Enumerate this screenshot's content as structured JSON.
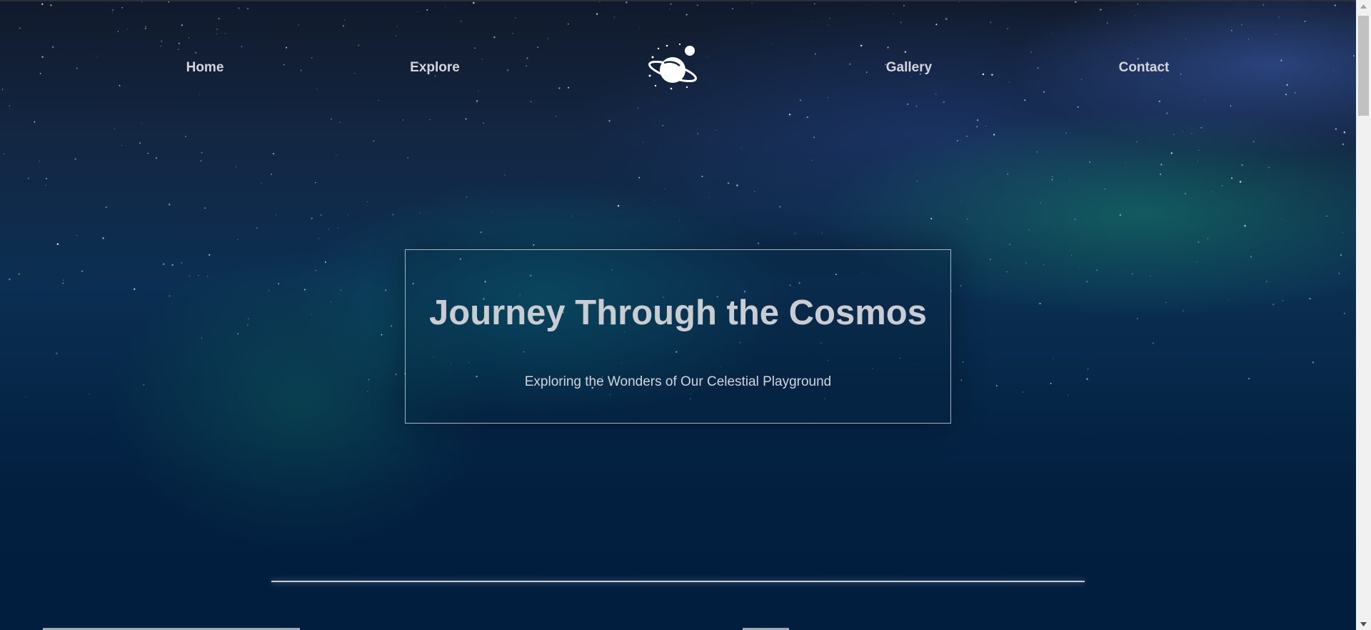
{
  "nav": {
    "items": [
      {
        "label": "Home"
      },
      {
        "label": "Explore"
      },
      {
        "label": "Gallery"
      },
      {
        "label": "Contact"
      }
    ],
    "logo": {
      "icon": "planet-icon"
    }
  },
  "hero": {
    "title": "Journey Through the Cosmos",
    "subtitle": "Exploring the Wonders of Our Celestial Playground"
  },
  "colors": {
    "background": "#021f3f",
    "nav_text": "#d4d6da",
    "title_text": "#c9ccd1",
    "box_border": "#dce4ec"
  },
  "scrollbar": {
    "icons": [
      "scroll-up-arrow-icon",
      "scroll-down-arrow-icon"
    ]
  }
}
